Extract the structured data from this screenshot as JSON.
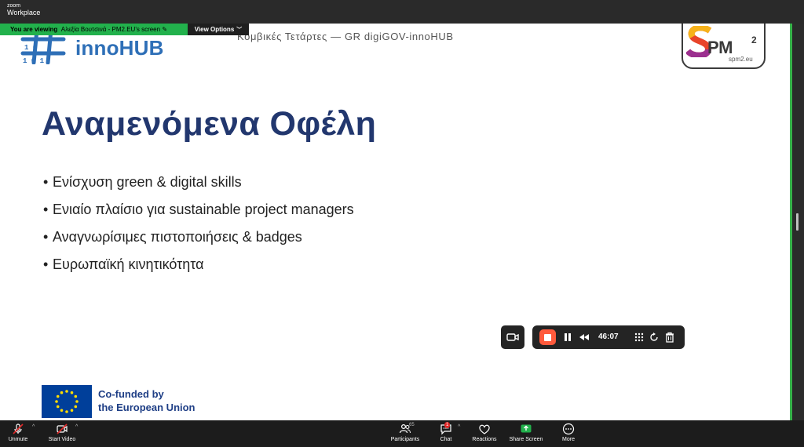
{
  "app": {
    "brand_top": "zoom",
    "brand_bottom": "Workplace"
  },
  "share_banner": {
    "prefix": "You are viewing",
    "presenter": "Αλεξία Βουτσινά - PM2.EU's screen",
    "view_options": "View Options"
  },
  "slide": {
    "header_logo_text": "innoHUB",
    "header_text": "Κομβικές Τετάρτες — GR digiGOV-innoHUB",
    "spm_logo": {
      "text": "PM",
      "superscript": "2",
      "url": "spm2.eu"
    },
    "title": "Αναμενόμενα Οφέλη",
    "bullets": [
      "Ενίσχυση green & digital skills",
      "Ενιαίο πλαίσιο για sustainable project managers",
      "Αναγνωρίσιμες πιστοποιήσεις & badges",
      "Ευρωπαϊκή κινητικότητα"
    ],
    "eu_logo": {
      "line1": "Co-funded by",
      "line2": "the European Union"
    },
    "colors": {
      "title": "#22376e",
      "innohub": "#2e6fb7",
      "eu_blue": "#003f9a",
      "eu_star": "#ffdd00"
    }
  },
  "recording": {
    "time": "46:07",
    "stop_color": "#ff5a3c"
  },
  "toolbar": {
    "unmute": "Unmute",
    "start_video": "Start Video",
    "participants": "Participants",
    "participants_count": "65",
    "chat": "Chat",
    "chat_badge": "1",
    "reactions": "Reactions",
    "share_screen": "Share Screen",
    "more": "More"
  },
  "icons": [
    "mic-muted-icon",
    "video-off-icon",
    "participants-icon",
    "chat-icon",
    "reactions-icon",
    "share-screen-icon",
    "more-icon",
    "record-stop-icon",
    "pause-icon",
    "rewind-icon",
    "grid-icon",
    "refresh-icon",
    "trash-icon",
    "camera-icon"
  ]
}
